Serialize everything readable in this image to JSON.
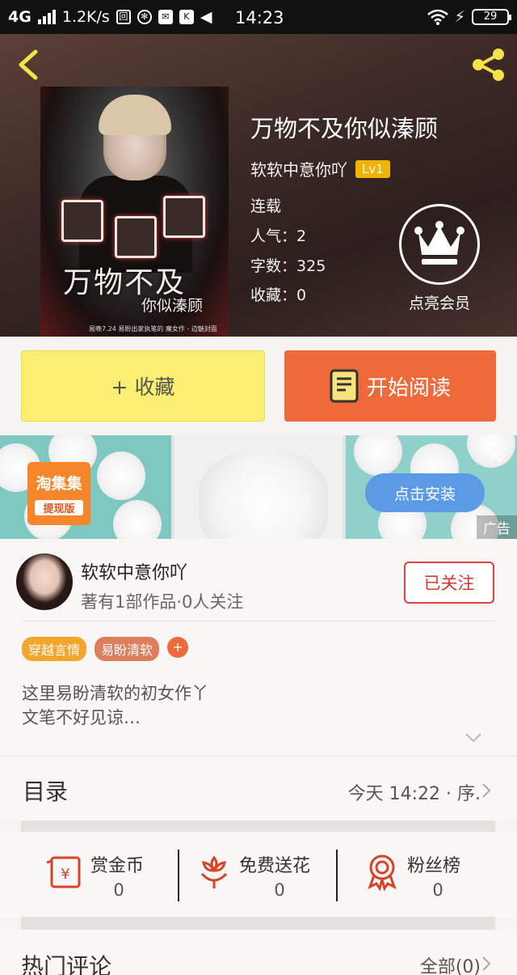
{
  "status_bar": {
    "network": "4G",
    "speed": "1.2K/s",
    "time": "14:23",
    "battery": "29"
  },
  "book": {
    "title": "万物不及你似溱顾",
    "author": "软软中意你吖",
    "level": "Lv1",
    "status": "连载",
    "popularity_label": "人气：",
    "popularity": "2",
    "words_label": "字数：",
    "words": "325",
    "favorites_label": "收藏：",
    "favorites": "0",
    "cover_title_main": "万物不及",
    "cover_title_sub": "你似溱顾",
    "cover_credit": "易晚7.24 易盼出家执笔的 魔女作 - 边魅封面"
  },
  "vip": {
    "label": "点亮会员"
  },
  "actions": {
    "favorite": "+ 收藏",
    "read": "开始阅读"
  },
  "ad": {
    "logo_text": "淘集集",
    "logo_sub": "提现版",
    "install": "点击安装",
    "tag": "广告",
    "close": "✕"
  },
  "author_card": {
    "name": "软软中意你吖",
    "stats": "著有1部作品·0人关注",
    "follow": "已关注",
    "tags": [
      "穿越言情",
      "易盼清软"
    ],
    "add_tag": "+",
    "intro_line1": "这里易盼清软的初女作丫",
    "intro_line2": "文笔不好见谅…"
  },
  "catalog": {
    "title": "目录",
    "latest": "今天 14:22 · 序."
  },
  "rewards": [
    {
      "label": "赏金币",
      "value": "0"
    },
    {
      "label": "免费送花",
      "value": "0"
    },
    {
      "label": "粉丝榜",
      "value": "0"
    }
  ],
  "comments": {
    "title": "热门评论",
    "all": "全部(0)"
  },
  "colors": {
    "accent_orange": "#ee6a3a",
    "favorite_yellow": "#fcee72",
    "follow_red": "#d33333",
    "level_badge": "#f0b400",
    "icon_red": "#d8432a"
  }
}
